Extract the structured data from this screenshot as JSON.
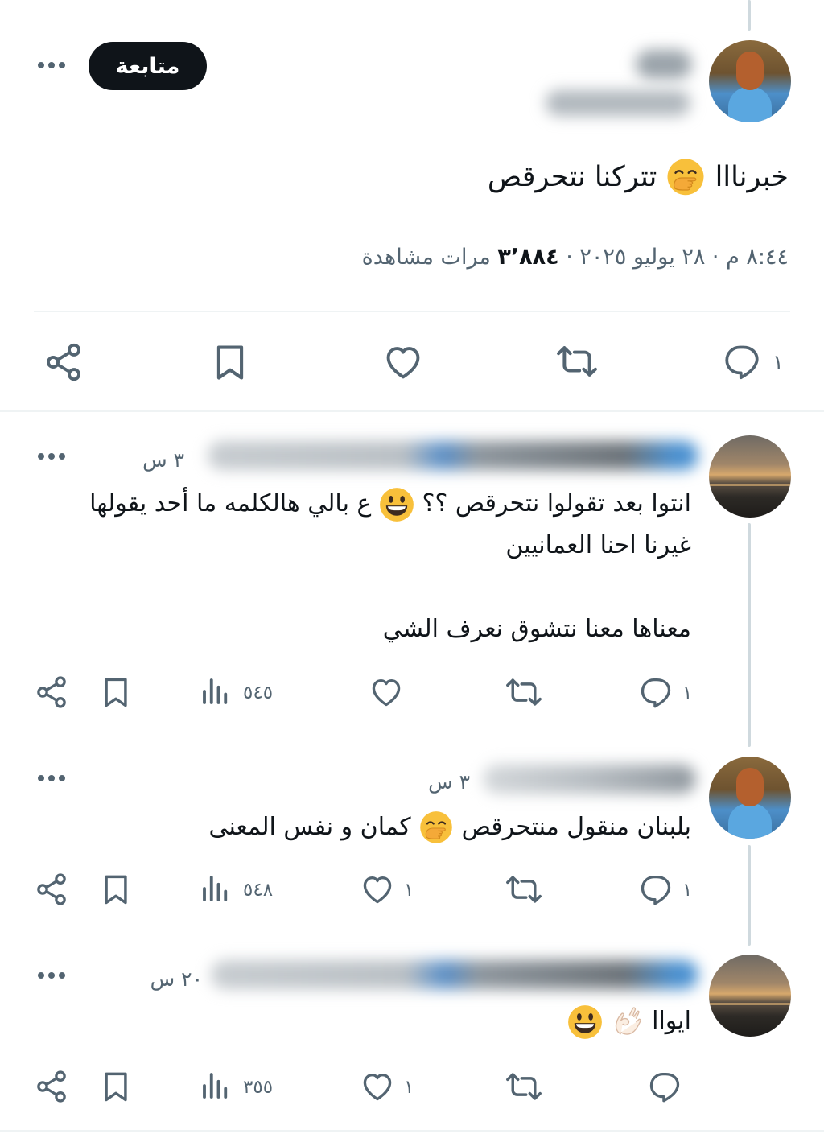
{
  "tweet": {
    "follow_label": "متابعة",
    "text_part1": "خبرنااا",
    "text_part2": "تتركنا نتحرقص",
    "meta_prefix": "٨:٤٤ م · ٢٨ يوليو ٢٠٢٥ · ",
    "views_count": "٣٬٨٨٤",
    "views_label": " مرات مشاهدة",
    "replies_count": "١"
  },
  "replies": [
    {
      "time": "٣ س",
      "line1_a": "انتوا بعد تقولوا نتحرقص ؟؟",
      "line1_b": "ع بالي هالكلمه ما أحد يقولها",
      "line2": "غيرنا احنا العمانيين",
      "line3": "معناها معنا نتشوق نعرف الشي",
      "replies_count": "١",
      "likes_count": "",
      "views_count": "٥٤٥"
    },
    {
      "time": "٣ س",
      "text_a": "بلبنان منقول منتحرقص",
      "text_b": "كمان و نفس المعنى",
      "replies_count": "١",
      "likes_count": "١",
      "views_count": "٥٤٨"
    },
    {
      "time": "٢٠ س",
      "text_a": "ايواا",
      "replies_count": "",
      "likes_count": "١",
      "views_count": "٣٥٥"
    }
  ],
  "icons": {
    "reply": "speech-bubble-icon",
    "retweet": "retweet-icon",
    "like": "heart-icon",
    "bookmark": "bookmark-icon",
    "share": "share-icon",
    "views": "bar-chart-icon",
    "more": "more-dots-icon"
  },
  "colors": {
    "text_primary": "#0f1419",
    "text_secondary": "#536471",
    "follow_bg": "#0f1419",
    "divider": "#eff3f4",
    "thread_line": "#cfd9de"
  }
}
